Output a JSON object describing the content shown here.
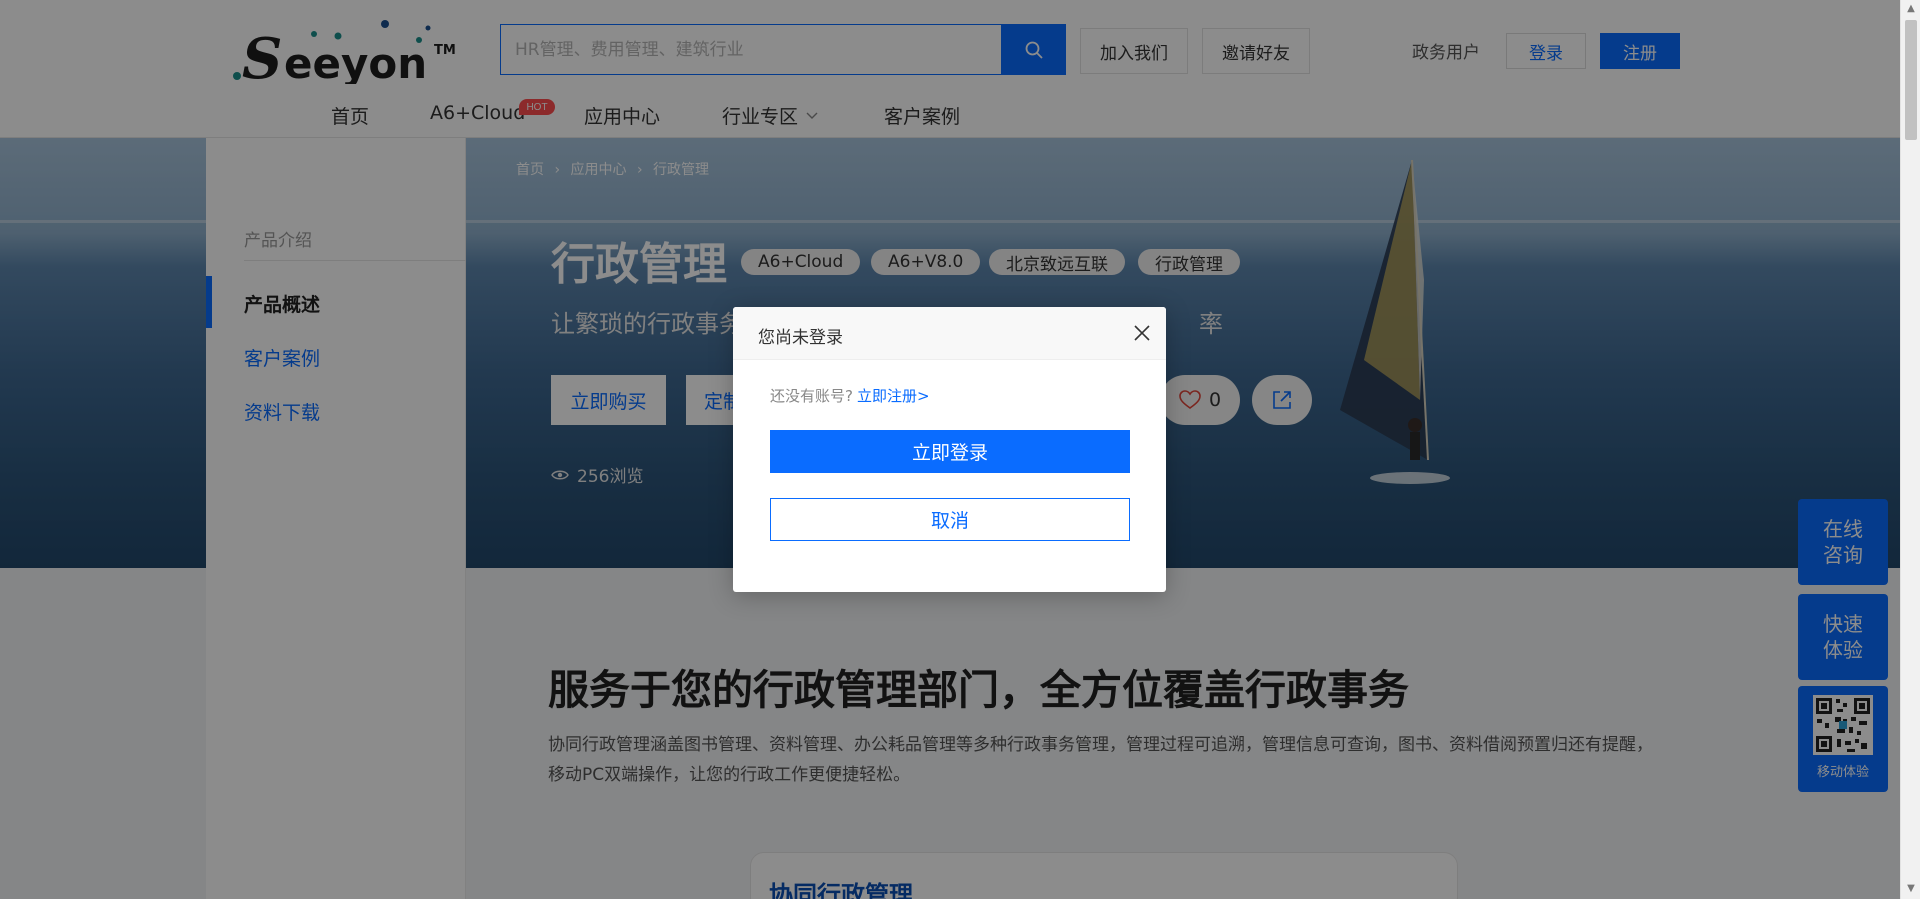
{
  "header": {
    "logo_text": "Seeyon",
    "logo_mark": "TM",
    "search": {
      "placeholder": "HR管理、费用管理、建筑行业",
      "value": ""
    },
    "join_us": "加入我们",
    "invite_friends": "邀请好友",
    "gov_user": "政务用户",
    "login": "登录",
    "register": "注册",
    "hot_badge": "HOT",
    "nav": [
      "首页",
      "A6+Cloud",
      "应用中心",
      "行业专区",
      "客户案例"
    ]
  },
  "breadcrumb": [
    "首页",
    "应用中心",
    "行政管理"
  ],
  "sidebar": {
    "heading": "产品介绍",
    "items": [
      {
        "label": "产品概述",
        "active": true
      },
      {
        "label": "客户案例",
        "active": false
      },
      {
        "label": "资料下载",
        "active": false
      }
    ]
  },
  "product": {
    "title": "行政管理",
    "tags": [
      "A6+Cloud",
      "A6+V8.0",
      "北京致远互联",
      "行政管理"
    ],
    "subtitle_left": "让繁琐的行政事务",
    "subtitle_right": "率",
    "buy_label": "立即购买",
    "custom_label": "定制",
    "likes": "0",
    "views": "256浏览"
  },
  "content": {
    "section_title": "服务于您的行政管理部门，全方位覆盖行政事务",
    "section_desc": "协同行政管理涵盖图书管理、资料管理、办公耗品管理等多种行政事务管理，管理过程可追溯，管理信息可查询，图书、资料借阅预置归还有提醒，移动PC双端操作，让您的行政工作更便捷轻松。",
    "preview_title": "协同行政管理"
  },
  "float_tools": {
    "online_consult": "在线\n咨询",
    "quick_trial": "快速\n体验",
    "mobile_trial": "移动体验"
  },
  "modal": {
    "title": "您尚未登录",
    "hint": "还没有账号?",
    "register_link": "立即注册>",
    "login_button": "立即登录",
    "cancel_button": "取消"
  },
  "colors": {
    "brand_blue": "#0a6cff",
    "hot_red": "#ff4d4f",
    "overlay": "rgba(0,0,0,0.45)"
  }
}
